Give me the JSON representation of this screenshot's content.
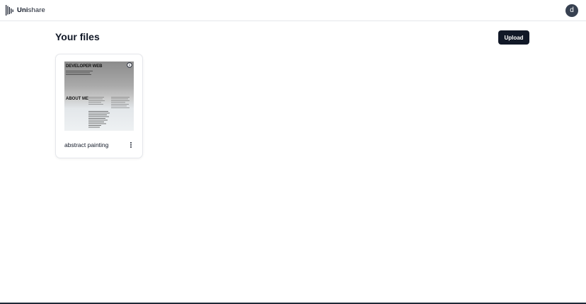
{
  "header": {
    "brand_bold": "Uni",
    "brand_rest": "share",
    "avatar_initial": "d",
    "avatar_color": "#374151"
  },
  "main": {
    "title": "Your files",
    "upload_label": "Upload"
  },
  "files": [
    {
      "name": "abstract painting",
      "thumbnail": {
        "heading": "DEVELOPER WEB",
        "subheading": "ABOUT ME"
      },
      "icons": [
        "info-icon",
        "more-vertical-icon"
      ]
    }
  ],
  "colors": {
    "accent": "#111827",
    "border": "#e5e7eb"
  }
}
